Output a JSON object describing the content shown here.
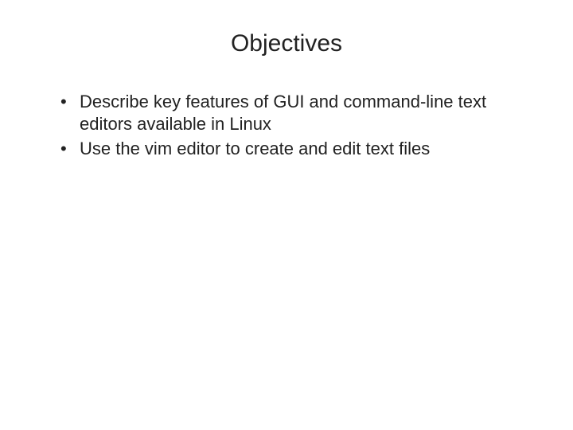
{
  "slide": {
    "title": "Objectives",
    "bullets": [
      "Describe key features of GUI and command-line text editors available in Linux",
      "Use the vim editor to create and edit text files"
    ]
  }
}
